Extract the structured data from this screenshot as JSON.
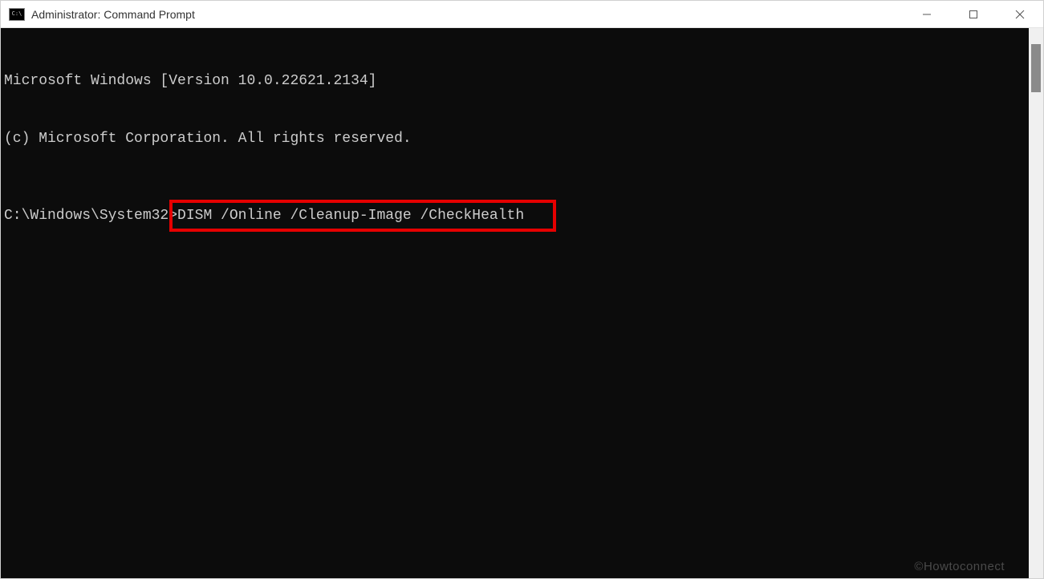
{
  "titlebar": {
    "icon_text": "C:\\",
    "title": "Administrator: Command Prompt"
  },
  "terminal": {
    "line1": "Microsoft Windows [Version 10.0.22621.2134]",
    "line2": "(c) Microsoft Corporation. All rights reserved.",
    "prompt": "C:\\Windows\\System32>",
    "command": "DISM /Online /Cleanup-Image /CheckHealth"
  },
  "watermark": "©Howtoconnect"
}
